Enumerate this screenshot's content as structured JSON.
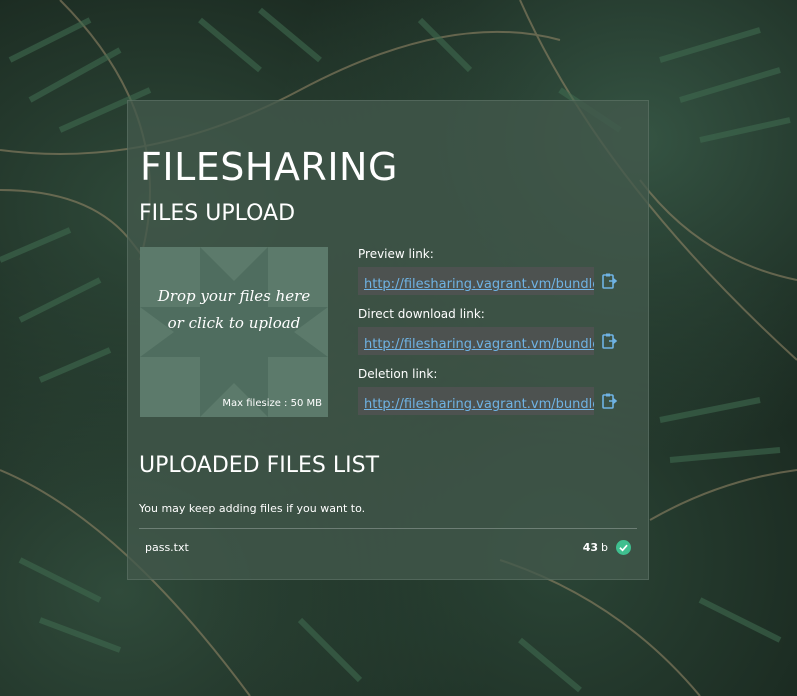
{
  "app": {
    "title": "FILESHARING"
  },
  "upload": {
    "heading": "FILES UPLOAD",
    "dropzone_text": "Drop your files here or click to upload",
    "max_filesize": "Max filesize : 50 MB"
  },
  "links": [
    {
      "label": "Preview link:",
      "url": "http://filesharing.vagrant.vm/bundle"
    },
    {
      "label": "Direct download link:",
      "url": "http://filesharing.vagrant.vm/bundle"
    },
    {
      "label": "Deletion link:",
      "url": "http://filesharing.vagrant.vm/bundle"
    }
  ],
  "list": {
    "heading": "UPLOADED FILES LIST",
    "note": "You may keep adding files if you want to.",
    "files": [
      {
        "name": "pass.txt",
        "size_value": "43",
        "size_unit": "b",
        "status": "uploaded"
      }
    ]
  },
  "colors": {
    "link": "#6fb3e4",
    "success": "#3fbf8f",
    "panel": "#42584c"
  },
  "icons": {
    "copy": "clipboard-copy-icon",
    "status": "check-circle-icon"
  }
}
